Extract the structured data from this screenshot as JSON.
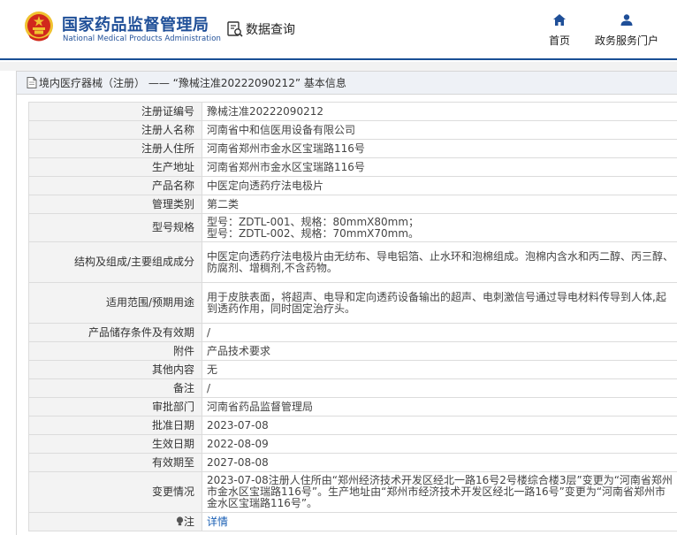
{
  "header": {
    "logo_cn": "国家药品监督管理局",
    "logo_en": "National Medical Products Administration",
    "search_label": "数据查询",
    "nav": [
      {
        "label": "首页",
        "icon": "home-icon"
      },
      {
        "label": "政务服务门户",
        "icon": "user-icon"
      }
    ]
  },
  "panel": {
    "title": "境内医疗器械（注册） —— “豫械注准20222090212” 基本信息",
    "rows": [
      {
        "key": "注册证编号",
        "value": "豫械注准20222090212"
      },
      {
        "key": "注册人名称",
        "value": "河南省中和信医用设备有限公司"
      },
      {
        "key": "注册人住所",
        "value": "河南省郑州市金水区宝瑞路116号"
      },
      {
        "key": "生产地址",
        "value": "河南省郑州市金水区宝瑞路116号"
      },
      {
        "key": "产品名称",
        "value": "中医定向透药疗法电极片"
      },
      {
        "key": "管理类别",
        "value": "第二类"
      },
      {
        "key": "型号规格",
        "value": "型号：ZDTL-001、规格：80mmX80mm；\n型号：ZDTL-002、规格：70mmX70mm。"
      },
      {
        "key": "结构及组成/主要组成成分",
        "value": "中医定向透药疗法电极片由无纺布、导电铝箔、止水环和泡棉组成。泡棉内含水和丙二醇、丙三醇、防腐剂、增稠剂,不含药物。"
      },
      {
        "key": "适用范围/预期用途",
        "value": "用于皮肤表面，将超声、电导和定向透药设备输出的超声、电刺激信号通过导电材料传导到人体,起到透药作用，同时固定治疗头。"
      },
      {
        "key": "产品储存条件及有效期",
        "value": "/"
      },
      {
        "key": "附件",
        "value": "产品技术要求"
      },
      {
        "key": "其他内容",
        "value": "无"
      },
      {
        "key": "备注",
        "value": "/"
      },
      {
        "key": "审批部门",
        "value": "河南省药品监督管理局"
      },
      {
        "key": "批准日期",
        "value": "2023-07-08"
      },
      {
        "key": "生效日期",
        "value": "2022-08-09"
      },
      {
        "key": "有效期至",
        "value": "2027-08-08"
      },
      {
        "key": "变更情况",
        "value": "2023-07-08注册人住所由“郑州经济技术开发区经北一路16号2号楼综合楼3层”变更为“河南省郑州市金水区宝瑞路116号”。生产地址由“郑州市经济技术开发区经北一路16号”变更为“河南省郑州市金水区宝瑞路116号”。"
      },
      {
        "key": "注",
        "value": "详情",
        "key_icon": "bulb-icon"
      }
    ]
  },
  "colors": {
    "brand_blue": "#1f4f98",
    "link_blue": "#1a5fb4",
    "emblem_red": "#d1281c",
    "emblem_gold": "#f0c230"
  }
}
